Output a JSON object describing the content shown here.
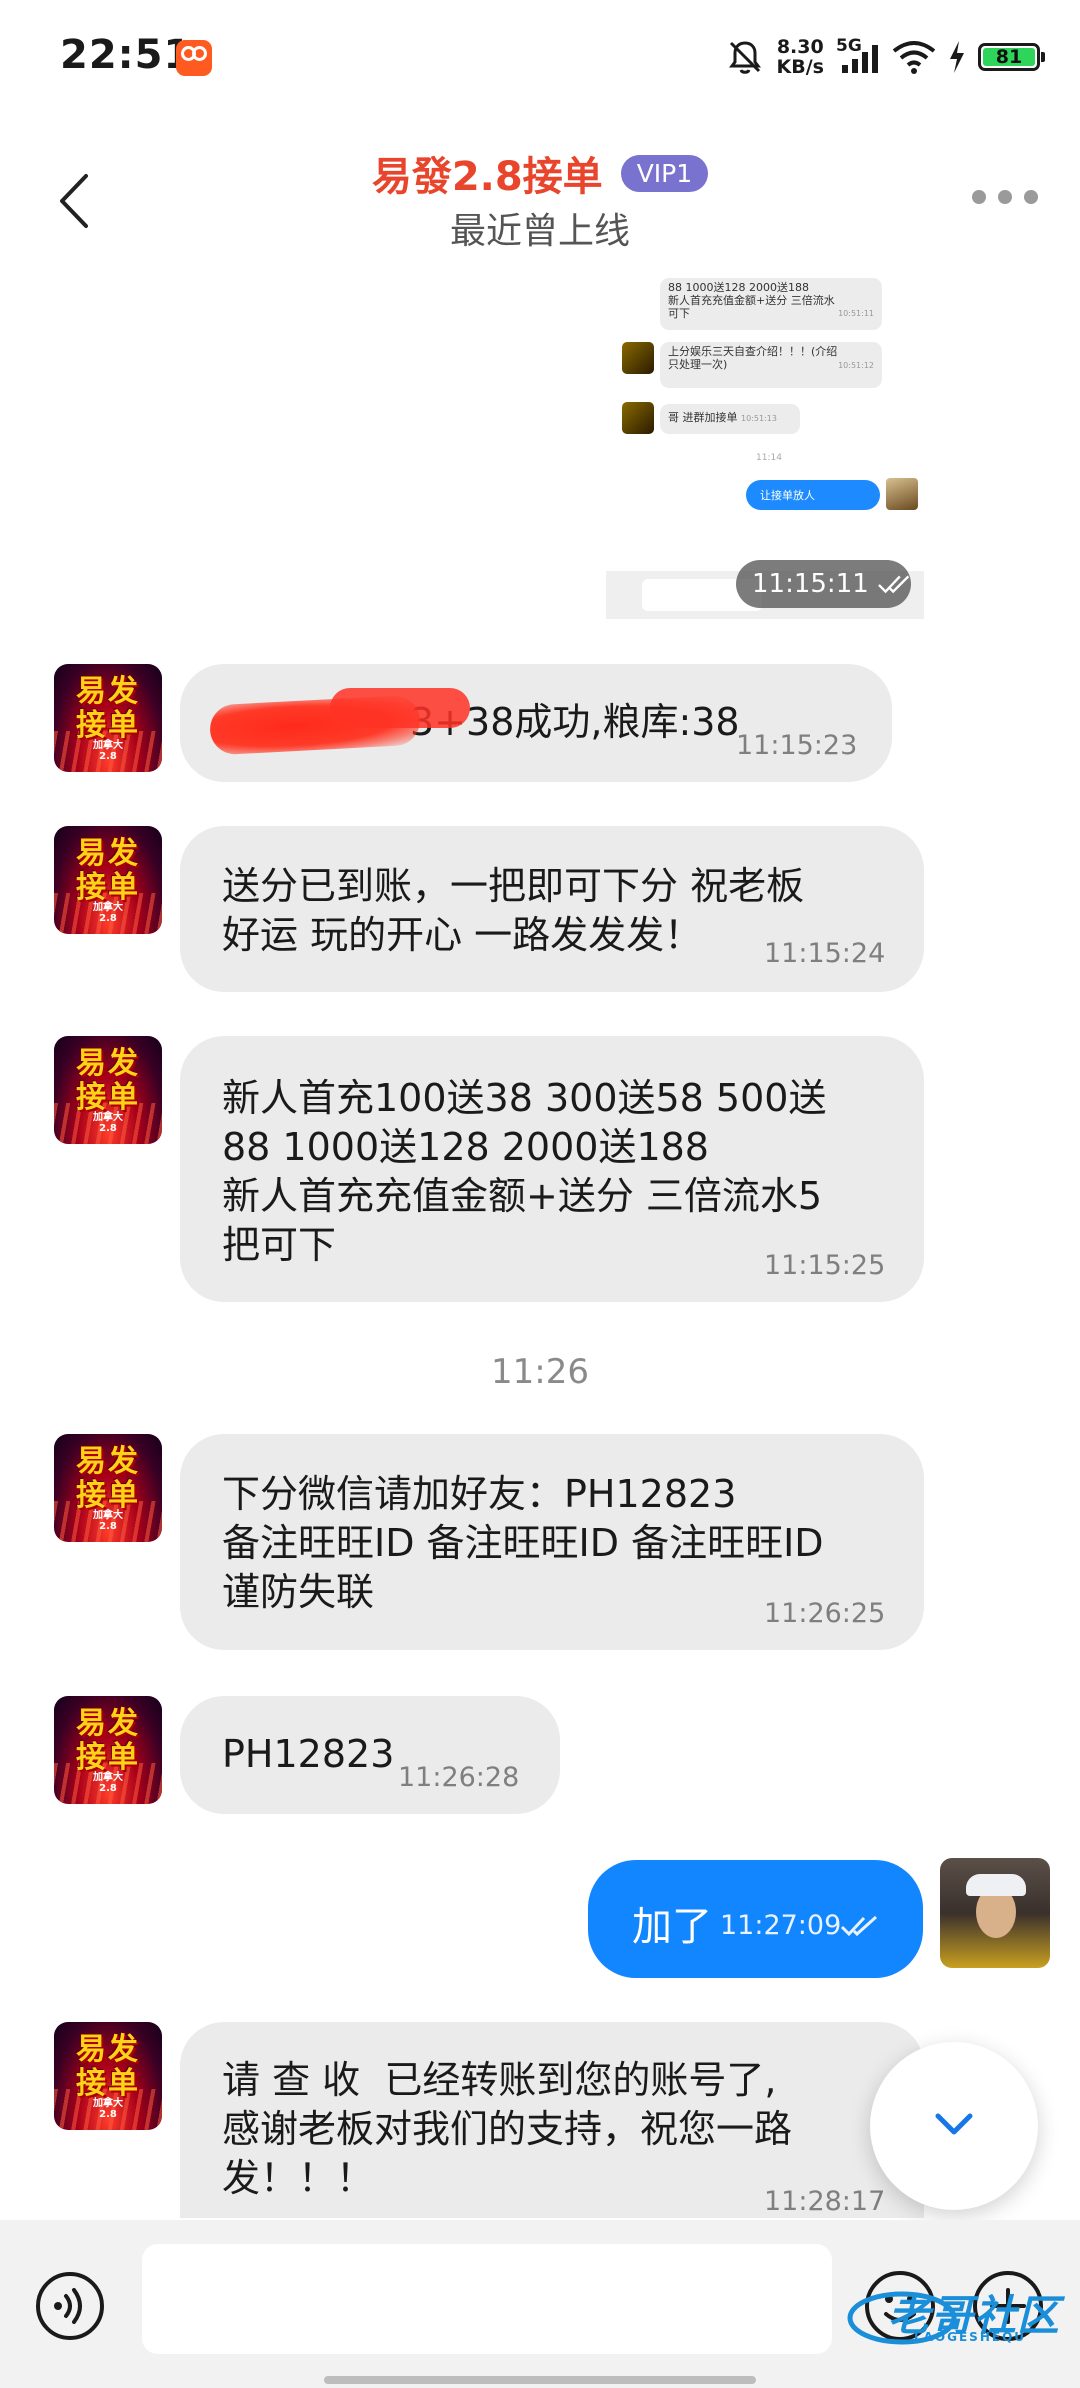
{
  "status_bar": {
    "time": "22:51",
    "speed_value": "8.30",
    "speed_unit": "KB/s",
    "network": "5G",
    "battery": "81",
    "icons": [
      "app-badge-icon",
      "mute-bell-icon",
      "signal-icon",
      "wifi-icon",
      "charging-icon",
      "battery-icon"
    ]
  },
  "header": {
    "title": "易發2.8接单",
    "badge": "VIP1",
    "subtitle": "最近曾上线"
  },
  "embedded_screenshot": {
    "lines": [
      "88 1000送128 2000送188",
      "新人首充充值金额+送分 三倍流水",
      "可下",
      "上分娱乐三天自查介绍！！！(介绍",
      "只处理一次)",
      "哥 进群加接单",
      "让接单放人",
      "11:15:11"
    ],
    "times": [
      "10:51:11",
      "10:51:12",
      "10:51:13",
      "11:14"
    ]
  },
  "avatar": {
    "line1": "易发",
    "line2": "接单",
    "line3": "加拿大",
    "line4": "2.8"
  },
  "messages": [
    {
      "text": "3+38成功,粮库:38",
      "time": "11:15:23"
    },
    {
      "text": "送分已到账，一把即可下分 祝老板\n好运 玩的开心 一路发发发！",
      "time": "11:15:24"
    },
    {
      "text": "新人首充100送38 300送58 500送\n88 1000送128 2000送188\n新人首充充值金额+送分 三倍流水5\n把可下",
      "time": "11:15:25"
    },
    {
      "text": "下分微信请加好友：PH12823\n备注旺旺ID 备注旺旺ID 备注旺旺ID\n谨防失联",
      "time": "11:26:25"
    },
    {
      "text": "PH12823",
      "time": "11:26:28"
    },
    {
      "text": "请 查 收  已经转账到您的账号了,\n感谢老板对我们的支持，祝您一路\n发！！！",
      "time": "11:28:17"
    }
  ],
  "center_time": "11:26",
  "my_message": {
    "text": "加了",
    "time": "11:27:09"
  },
  "watermark": {
    "text": "老哥社区",
    "sub": "LAOGESHEQU"
  }
}
